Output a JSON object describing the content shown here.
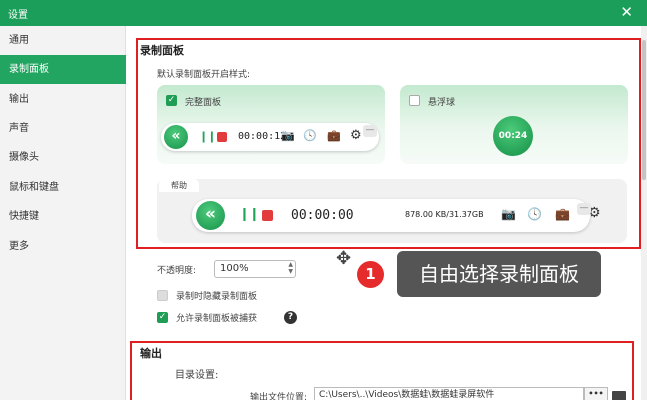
{
  "window": {
    "title": "设置",
    "close_glyph": "✕"
  },
  "sidebar": {
    "items": [
      {
        "label": "通用"
      },
      {
        "label": "录制面板",
        "active": true
      },
      {
        "label": "输出"
      },
      {
        "label": "声音"
      },
      {
        "label": "摄像头"
      },
      {
        "label": "鼠标和键盘"
      },
      {
        "label": "快捷键"
      },
      {
        "label": "更多"
      }
    ]
  },
  "record_panel": {
    "title": "录制面板",
    "default_style_label": "默认录制面板开启样式:",
    "full_panel": {
      "label": "完整面板",
      "checked": true,
      "time": "00:00:12"
    },
    "floating_ball": {
      "label": "悬浮球",
      "checked": false,
      "time": "00:24"
    },
    "help": {
      "tab_label": "帮助",
      "time": "00:00:00",
      "size": "878.00 KB/31.37GB"
    },
    "minimize_glyph": "—"
  },
  "opacity": {
    "label": "不透明度:",
    "value": "100%"
  },
  "options": {
    "hide_when_recording": {
      "label": "录制时隐藏录制面板",
      "checked": false,
      "enabled": false
    },
    "allow_capture": {
      "label": "允许录制面板被捕获",
      "checked": true
    },
    "help_glyph": "?"
  },
  "callout": {
    "number": "1",
    "text": "自由选择录制面板"
  },
  "output": {
    "title": "输出",
    "dir_settings_label": "目录设置:",
    "output_path_label": "输出文件位置:",
    "output_path_value": "C:\\Users\\..\\Videos\\数据蛙\\数据蛙录屏软件",
    "browse_label": "•••"
  },
  "icons": {
    "play_glyph": "«",
    "pause_glyph": "❙❙",
    "camera": "📷",
    "clock": "🕓",
    "toolbox": "💼",
    "gear": "⚙",
    "move": "✥"
  },
  "colors": {
    "titlebar": "#1a9e5a",
    "active_nav": "#22a560",
    "highlight_border": "#e02020",
    "callout_bg": "#555555",
    "callout_badge": "#e52b2b"
  }
}
